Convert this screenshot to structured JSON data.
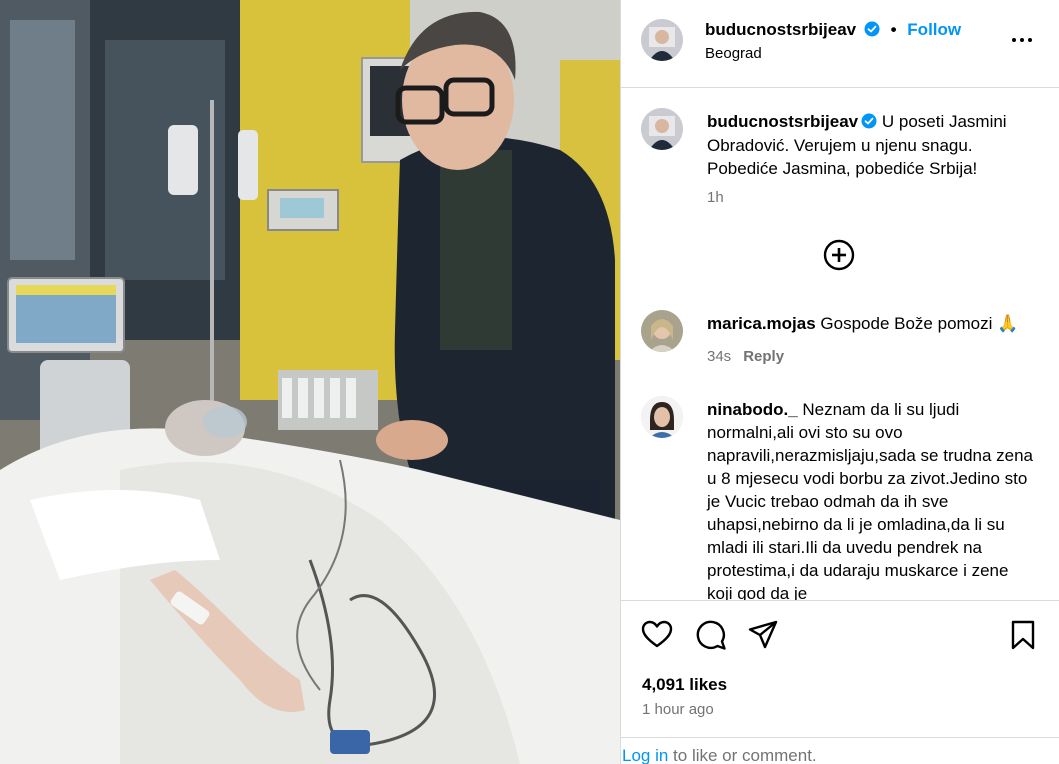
{
  "post": {
    "username": "buducnostsrbijeav",
    "follow_label": "Follow",
    "location": "Beograd",
    "caption": "U poseti Jasmini Obradović. Verujem u njenu snagu. Pobediće Jasmina, pobediće Srbija!",
    "caption_time": "1h",
    "likes": "4,091 likes",
    "posted_ago": "1 hour ago"
  },
  "comments": [
    {
      "username": "marica.mojas",
      "text": "Gospode Bože pomozi 🙏",
      "time": "34s",
      "reply_label": "Reply"
    },
    {
      "username": "ninabodo._",
      "text": "Neznam da li su ljudi normalni,ali ovi sto su ovo napravili,nerazmisljaju,sada se trudna zena u 8 mjesecu vodi borbu za zivot.Jedino sto je Vucic trebao odmah da ih sve uhapsi,nebirno da li je omladina,da li su mladi ili stari.Ili da uvedu pendrek na protestima,i da udaraju muskarce i zene koji god da je"
    }
  ],
  "footer": {
    "login_link": "Log in",
    "login_rest": " to like or comment."
  },
  "icons": {
    "verified": "verified-badge-icon",
    "more": "more-options-icon",
    "load_more": "plus-circle-icon",
    "like": "heart-icon",
    "comment": "comment-icon",
    "share": "share-icon",
    "save": "bookmark-icon"
  },
  "colors": {
    "accent": "#0095f6",
    "muted": "#737373",
    "border": "#dbdbdb"
  }
}
